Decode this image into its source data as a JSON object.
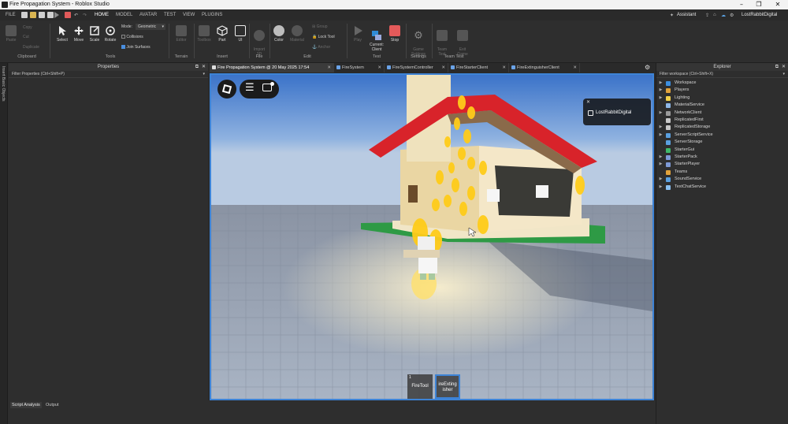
{
  "window": {
    "title": "Fire Propagation System - Roblox Studio"
  },
  "menu": {
    "file": "FILE",
    "tabs": [
      "HOME",
      "MODEL",
      "AVATAR",
      "TEST",
      "VIEW",
      "PLUGINS"
    ],
    "assistant": "Assistant",
    "user": "LostRabbitDigital"
  },
  "ribbon": {
    "clipboard": {
      "paste": "Paste",
      "copy": "Copy",
      "cut": "Cut",
      "duplicate": "Duplicate",
      "group": "Clipboard"
    },
    "tools": {
      "select": "Select",
      "move": "Move",
      "scale": "Scale",
      "rotate": "Rotate",
      "mode_label": "Mode:",
      "mode_value": "Geometric",
      "collisions": "Collisions",
      "join_surfaces": "Join Surfaces",
      "group": "Tools"
    },
    "terrain": {
      "editor": "Editor",
      "group": "Terrain"
    },
    "insert": {
      "toolbox": "Toolbox",
      "part": "Part",
      "ui": "UI",
      "group": "Insert"
    },
    "file": {
      "import3d": "Import\n3D",
      "group": "File"
    },
    "edit": {
      "color": "Color",
      "material": "Material",
      "group_btn": "Group",
      "lock_tool": "Lock Tool",
      "anchor": "Anchor",
      "group": "Edit"
    },
    "test": {
      "play": "Play",
      "current_client": "Current:\nClient",
      "stop": "Stop",
      "group": "Test"
    },
    "settings": {
      "game_settings": "Game\nSettings",
      "group": "Settings"
    },
    "team_test": {
      "team_test": "Team\nTest",
      "exit_game": "Exit\nGame",
      "group": "Team Test"
    }
  },
  "left_strip": {
    "label": "Insert Basic Objects"
  },
  "properties": {
    "title": "Properties",
    "filter": "Filter Properties (Ctrl+Shift+P)",
    "bottom_tabs": [
      "Script Analysis",
      "Output"
    ]
  },
  "doc_tabs": [
    {
      "label": "Fire Propagation System @ 20 May 2025 17:54",
      "active": true
    },
    {
      "label": "FireSystem",
      "active": false
    },
    {
      "label": "FireSystemController",
      "active": false
    },
    {
      "label": "FireStarterClient",
      "active": false
    },
    {
      "label": "FireExtinguisherClient",
      "active": false
    }
  ],
  "viewport": {
    "player_name": "LostRabbitDigital",
    "hotbar": [
      {
        "number": "1",
        "label": "FireTool",
        "selected": false
      },
      {
        "number": "",
        "label": "ireExting\nisher",
        "selected": true
      }
    ]
  },
  "explorer": {
    "title": "Explorer",
    "filter": "Filter workspace (Ctrl+Shift+X)",
    "items": [
      {
        "label": "Workspace",
        "expandable": true,
        "color": "#3b8ee0"
      },
      {
        "label": "Players",
        "expandable": true,
        "color": "#e0a23b"
      },
      {
        "label": "Lighting",
        "expandable": true,
        "color": "#f2d04a"
      },
      {
        "label": "MaterialService",
        "expandable": false,
        "color": "#8fb8e8"
      },
      {
        "label": "NetworkClient",
        "expandable": true,
        "color": "#9a9a9a"
      },
      {
        "label": "ReplicatedFirst",
        "expandable": false,
        "color": "#c9c9c9"
      },
      {
        "label": "ReplicatedStorage",
        "expandable": true,
        "color": "#c9c9c9"
      },
      {
        "label": "ServerScriptService",
        "expandable": true,
        "color": "#5aa0e0"
      },
      {
        "label": "ServerStorage",
        "expandable": false,
        "color": "#5aa0e0"
      },
      {
        "label": "StarterGui",
        "expandable": false,
        "color": "#3fb86a"
      },
      {
        "label": "StarterPack",
        "expandable": true,
        "color": "#7e9ad6"
      },
      {
        "label": "StarterPlayer",
        "expandable": true,
        "color": "#7e9ad6"
      },
      {
        "label": "Teams",
        "expandable": false,
        "color": "#e0a23b"
      },
      {
        "label": "SoundService",
        "expandable": true,
        "color": "#5aa0e0"
      },
      {
        "label": "TextChatService",
        "expandable": true,
        "color": "#8ac0f0"
      }
    ]
  }
}
